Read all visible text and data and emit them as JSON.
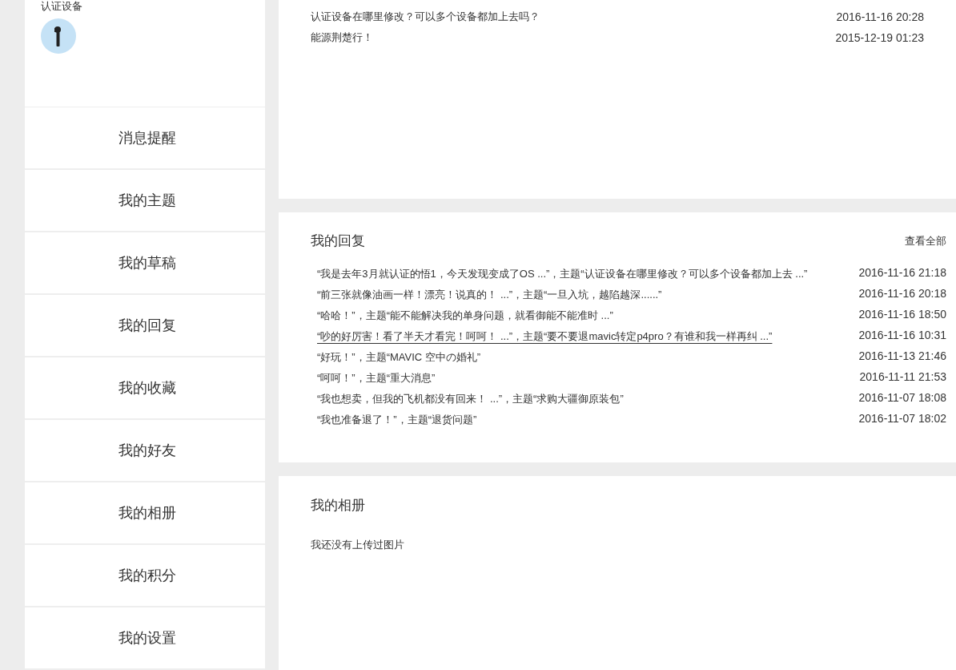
{
  "sidebar": {
    "device_label": "认证设备",
    "menu": [
      {
        "label": "消息提醒"
      },
      {
        "label": "我的主题"
      },
      {
        "label": "我的草稿"
      },
      {
        "label": "我的回复"
      },
      {
        "label": "我的收藏"
      },
      {
        "label": "我的好友"
      },
      {
        "label": "我的相册"
      },
      {
        "label": "我的积分"
      },
      {
        "label": "我的设置"
      }
    ]
  },
  "topics": [
    {
      "title": "认证设备在哪里修改？可以多个设备都加上去吗？",
      "time": "2016-11-16 20:28"
    },
    {
      "title": "能源荆楚行！",
      "time": "2015-12-19 01:23"
    }
  ],
  "replies": {
    "title": "我的回复",
    "view_all": "查看全部",
    "rows": [
      {
        "text": "“我是去年3月就认证的悟1，今天发现变成了OS ...”，主题“认证设备在哪里修改？可以多个设备都加上去 ...”",
        "time": "2016-11-16 21:18",
        "hovered": false
      },
      {
        "text": "“前三张就像油画一样！漂亮！说真的！ ...”，主题“一旦入坑，越陷越深......”",
        "time": "2016-11-16 20:18",
        "hovered": false
      },
      {
        "text": "“哈哈！”，主题“能不能解决我的单身问题，就看御能不能准时 ...”",
        "time": "2016-11-16 18:50",
        "hovered": false
      },
      {
        "text": "“吵的好厉害！看了半天才看完！呵呵！ ...”，主题“要不要退mavic转定p4pro？有谁和我一样再纠 ...”",
        "time": "2016-11-16 10:31",
        "hovered": true
      },
      {
        "text": "“好玩！”，主题“MAVIC 空中の婚礼”",
        "time": "2016-11-13 21:46",
        "hovered": false
      },
      {
        "text": "“呵呵！”，主题“重大消息”",
        "time": "2016-11-11 21:53",
        "hovered": false
      },
      {
        "text": "“我也想卖，但我的飞机都没有回来！ ...”，主题“求购大疆御原装包”",
        "time": "2016-11-07 18:08",
        "hovered": false
      },
      {
        "text": "“我也准备退了！”，主题“退货问题”",
        "time": "2016-11-07 18:02",
        "hovered": false
      }
    ]
  },
  "album": {
    "title": "我的相册",
    "empty_text": "我还没有上传过图片"
  }
}
